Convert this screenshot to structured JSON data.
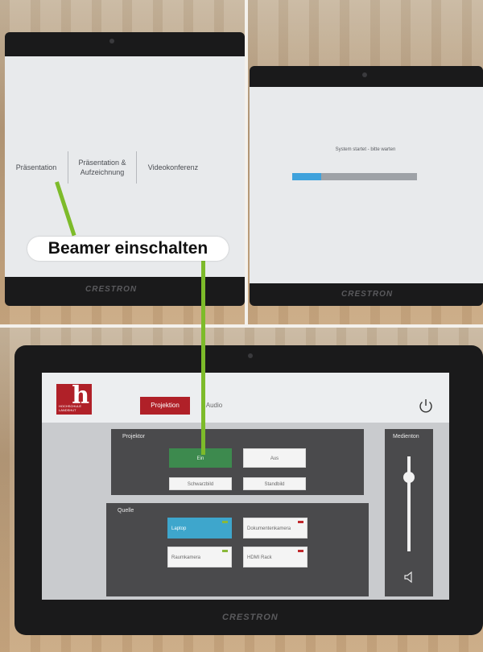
{
  "panel1": {
    "menu_items": [
      "Präsentation",
      "Präsentation & Aufzeichnung",
      "Videokonferenz"
    ],
    "brand": "CRESTRON"
  },
  "panel2": {
    "status_text": "System startet - bitte warten",
    "progress": 0.23,
    "brand": "CRESTRON"
  },
  "panel3": {
    "logo_letter": "h",
    "logo_text": "HOCHSCHULE LANDSHUT",
    "tabs": [
      "Projektion",
      "Audio"
    ],
    "active_tab": "Projektion",
    "projector": {
      "title": "Projektor",
      "on": "Ein",
      "off": "Aus",
      "blank": "Schwarzbild",
      "freeze": "Standbild"
    },
    "source": {
      "title": "Quelle",
      "items": [
        "Laptop",
        "Dokumentenkamera",
        "Raumkamera",
        "HDMI Rack"
      ]
    },
    "volume": {
      "title": "Medienton",
      "level": 0.78
    },
    "brand": "CRESTRON"
  },
  "callout": "Beamer einschalten",
  "colors": {
    "accent_red": "#b02028",
    "active_green": "#3d8a4e",
    "laptop_blue": "#3ea6cc",
    "pointer_green": "#7dbb2a",
    "progress_blue": "#3fa2dc"
  }
}
